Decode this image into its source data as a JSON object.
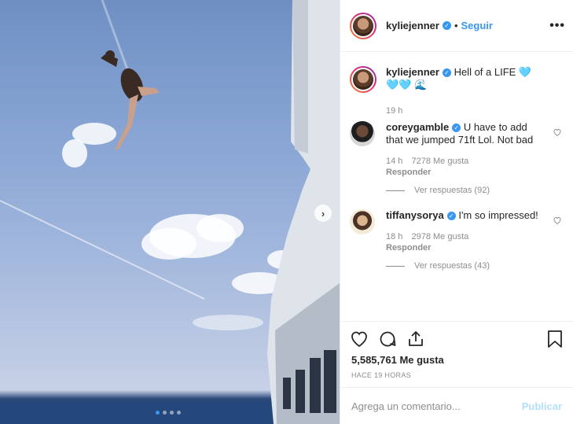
{
  "post": {
    "image_alt_icon": "photo-of-jump-from-yacht",
    "carousel": {
      "total": 4,
      "active": 0
    },
    "author": {
      "username": "kyliejenner",
      "verified": true,
      "separator": "•",
      "follow_label": "Seguir",
      "more_icon": "more-horizontal-icon"
    },
    "caption": {
      "username": "kyliejenner",
      "text": "Hell of a LIFE 🩵🩵🩵 🌊",
      "time": "19 h"
    },
    "comments": [
      {
        "username": "coreygamble",
        "text": "U have to add that we jumped 71ft Lol. Not bad",
        "time": "14 h",
        "likes": "7278 Me gusta",
        "reply": "Responder",
        "view_replies": "Ver respuestas (92)"
      },
      {
        "username": "tiffanysorya",
        "text": "I'm so impressed!",
        "time": "18 h",
        "likes": "2978 Me gusta",
        "reply": "Responder",
        "view_replies": "Ver respuestas (43)"
      }
    ],
    "likes_count": "5,585,761 Me gusta",
    "timestamp": "HACE 19 HORAS",
    "add_comment_placeholder": "Agrega un comentario...",
    "publish_label": "Publicar",
    "colors": {
      "accent": "#3897f0",
      "muted": "#8e8e8e",
      "publish_disabled": "#b2dffc"
    }
  }
}
